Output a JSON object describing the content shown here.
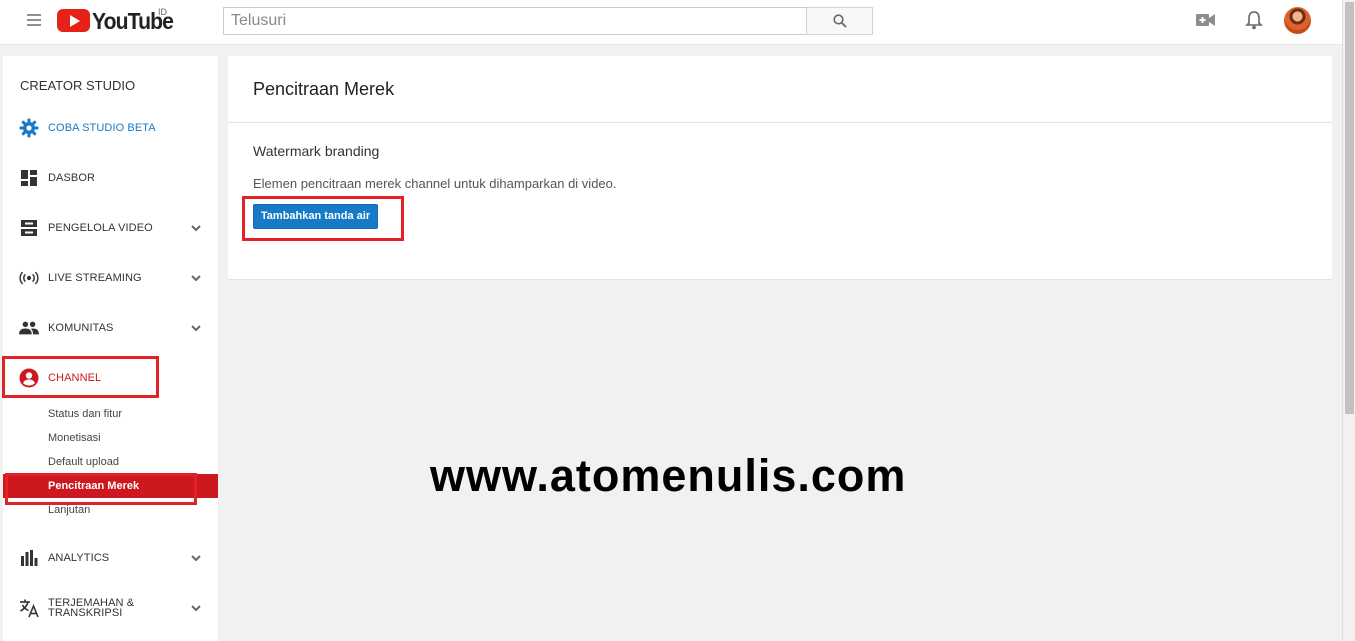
{
  "header": {
    "logo_text": "YouTube",
    "region": "ID",
    "search_placeholder": "Telusuri",
    "icons": [
      "menu-icon",
      "search-icon",
      "upload-video-icon",
      "notification-bell-icon",
      "avatar"
    ]
  },
  "sidebar": {
    "title": "CREATOR STUDIO",
    "items": [
      {
        "label": "COBA STUDIO BETA",
        "icon": "gear-icon"
      },
      {
        "label": "DASBOR",
        "icon": "dashboard-icon"
      },
      {
        "label": "PENGELOLA VIDEO",
        "icon": "video-manager-icon"
      },
      {
        "label": "LIVE STREAMING",
        "icon": "live-icon"
      },
      {
        "label": "KOMUNITAS",
        "icon": "community-icon"
      },
      {
        "label": "CHANNEL",
        "icon": "account-circle-icon"
      },
      {
        "label": "ANALYTICS",
        "icon": "bar-chart-icon"
      },
      {
        "label": "TERJEMAHAN &",
        "label2": "TRANSKRIPSI",
        "icon": "translate-icon"
      }
    ],
    "channel_sub": [
      "Status dan fitur",
      "Monetisasi",
      "Default upload",
      "Pencitraan Merek",
      "Lanjutan"
    ]
  },
  "main": {
    "title": "Pencitraan Merek",
    "section_title": "Watermark branding",
    "section_desc": "Elemen pencitraan merek channel untuk dihamparkan di video.",
    "add_button": "Tambahkan tanda air"
  },
  "overlay_text": "www.atomenulis.com",
  "colors": {
    "accent_red": "#cc181e",
    "highlight_red": "#e32127",
    "primary_blue": "#167ac6"
  }
}
